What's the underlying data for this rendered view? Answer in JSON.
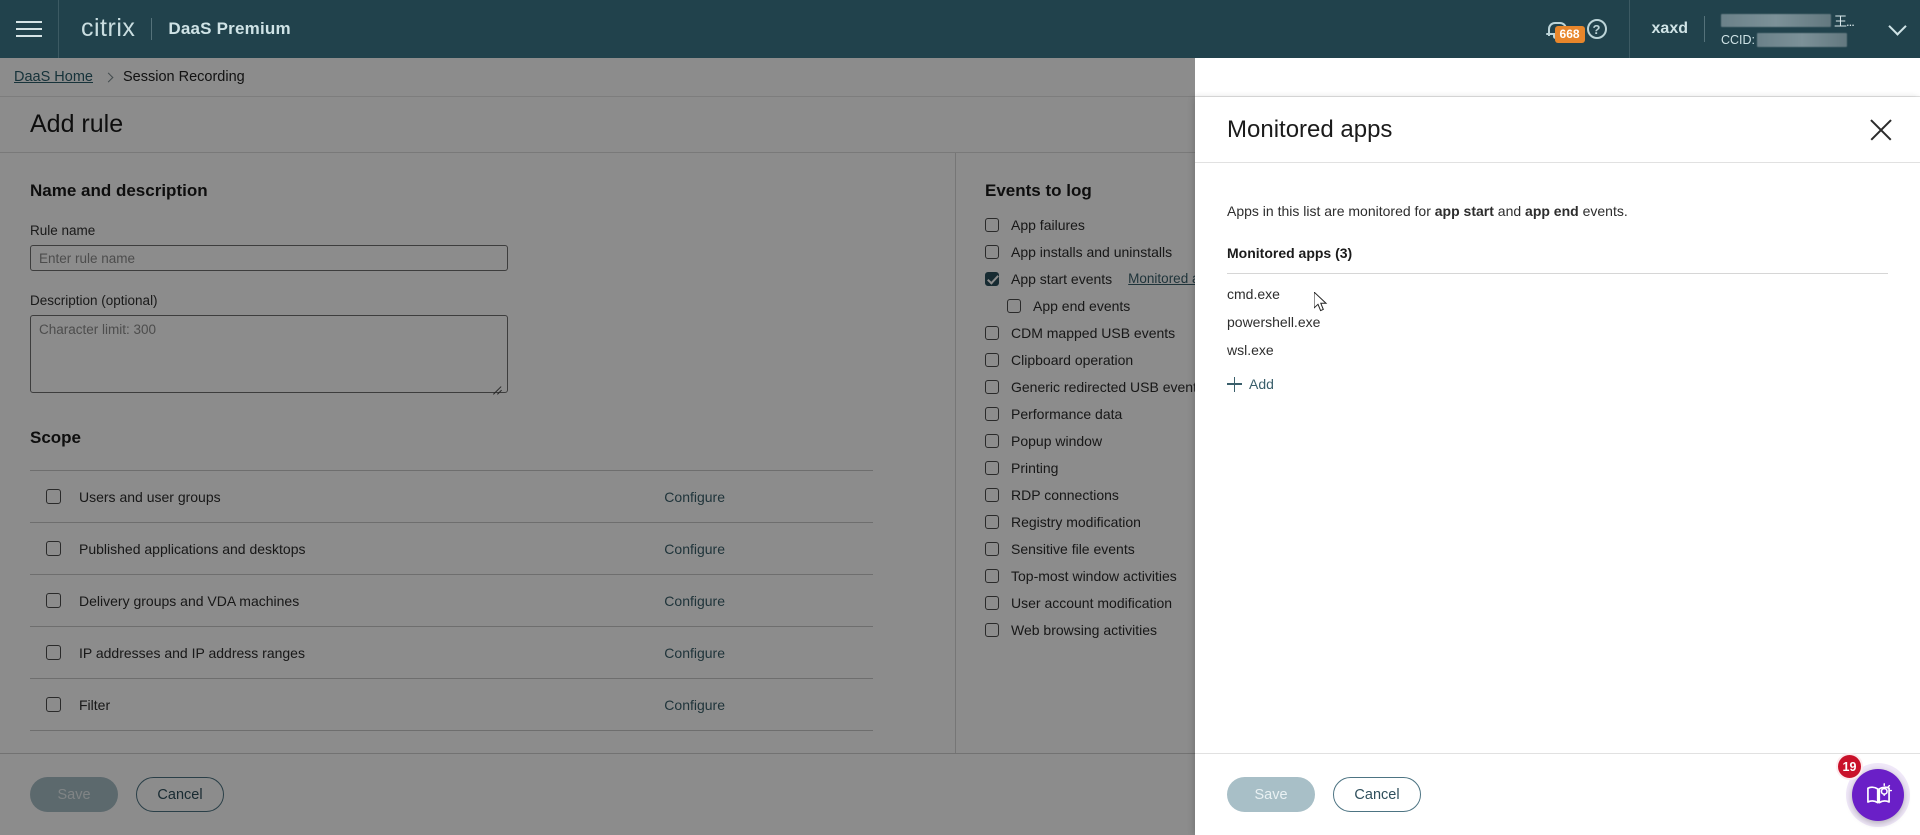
{
  "topbar": {
    "menu_icon": "hamburger-icon",
    "logo_text": "citrix",
    "product": "DaaS Premium",
    "notification_count": "668",
    "help_glyph": "?",
    "user_name": "xaxd",
    "customer_tail": "王...",
    "ccid_label": "CCID:"
  },
  "breadcrumb": {
    "home": "DaaS Home",
    "current": "Session Recording"
  },
  "page": {
    "title": "Add rule"
  },
  "name_section": {
    "heading": "Name and description",
    "rule_name_label": "Rule name",
    "rule_name_placeholder": "Enter rule name",
    "rule_name_value": "",
    "description_label": "Description (optional)",
    "description_placeholder": "Character limit: 300",
    "description_value": ""
  },
  "scope": {
    "heading": "Scope",
    "configure_label": "Configure",
    "rows": [
      {
        "label": "Users and user groups",
        "checked": false,
        "action": "Configure"
      },
      {
        "label": "Published applications and desktops",
        "checked": false,
        "action": "Configure"
      },
      {
        "label": "Delivery groups and VDA machines",
        "checked": false,
        "action": "Configure"
      },
      {
        "label": "IP addresses and IP address ranges",
        "checked": false,
        "action": "Configure"
      },
      {
        "label": "Filter",
        "checked": false,
        "action": "Configure"
      }
    ]
  },
  "events": {
    "heading": "Events to log",
    "items": [
      {
        "label": "App failures",
        "checked": false,
        "indent": false,
        "link": ""
      },
      {
        "label": "App installs and uninstalls",
        "checked": false,
        "indent": false,
        "link": ""
      },
      {
        "label": "App start events",
        "checked": true,
        "indent": false,
        "link": "Monitored apps"
      },
      {
        "label": "App end events",
        "checked": false,
        "indent": true,
        "link": ""
      },
      {
        "label": "CDM mapped USB events",
        "checked": false,
        "indent": false,
        "link": ""
      },
      {
        "label": "Clipboard operation",
        "checked": false,
        "indent": false,
        "link": ""
      },
      {
        "label": "Generic redirected USB events",
        "checked": false,
        "indent": false,
        "link": ""
      },
      {
        "label": "Performance data",
        "checked": false,
        "indent": false,
        "link": ""
      },
      {
        "label": "Popup window",
        "checked": false,
        "indent": false,
        "link": ""
      },
      {
        "label": "Printing",
        "checked": false,
        "indent": false,
        "link": ""
      },
      {
        "label": "RDP connections",
        "checked": false,
        "indent": false,
        "link": ""
      },
      {
        "label": "Registry modification",
        "checked": false,
        "indent": false,
        "link": ""
      },
      {
        "label": "Sensitive file events",
        "checked": false,
        "indent": false,
        "link": ""
      },
      {
        "label": "Top-most window activities",
        "checked": false,
        "indent": false,
        "link": ""
      },
      {
        "label": "User account modification",
        "checked": false,
        "indent": false,
        "link": ""
      },
      {
        "label": "Web browsing activities",
        "checked": false,
        "indent": false,
        "link": ""
      }
    ]
  },
  "form_footer": {
    "save": "Save",
    "cancel": "Cancel"
  },
  "panel": {
    "title": "Monitored apps",
    "description_prefix": "Apps in this list are monitored for ",
    "description_bold1": "app start",
    "description_mid": " and ",
    "description_bold2": "app end",
    "description_suffix": " events.",
    "subheading": "Monitored apps (3)",
    "apps": [
      "cmd.exe",
      "powershell.exe",
      "wsl.exe"
    ],
    "add_label": "Add",
    "save": "Save",
    "cancel": "Cancel"
  },
  "fab": {
    "badge": "19",
    "icon": "book-idea-icon"
  },
  "colors": {
    "header_bg": "#21424c",
    "accent_link": "#3a5f6b",
    "checkbox_checked": "#2b4f5b",
    "notification_badge": "#e8862b",
    "fab_purple": "#6a1fc7",
    "fab_badge_red": "#c9112a",
    "primary_disabled": "#a8bfc7"
  }
}
